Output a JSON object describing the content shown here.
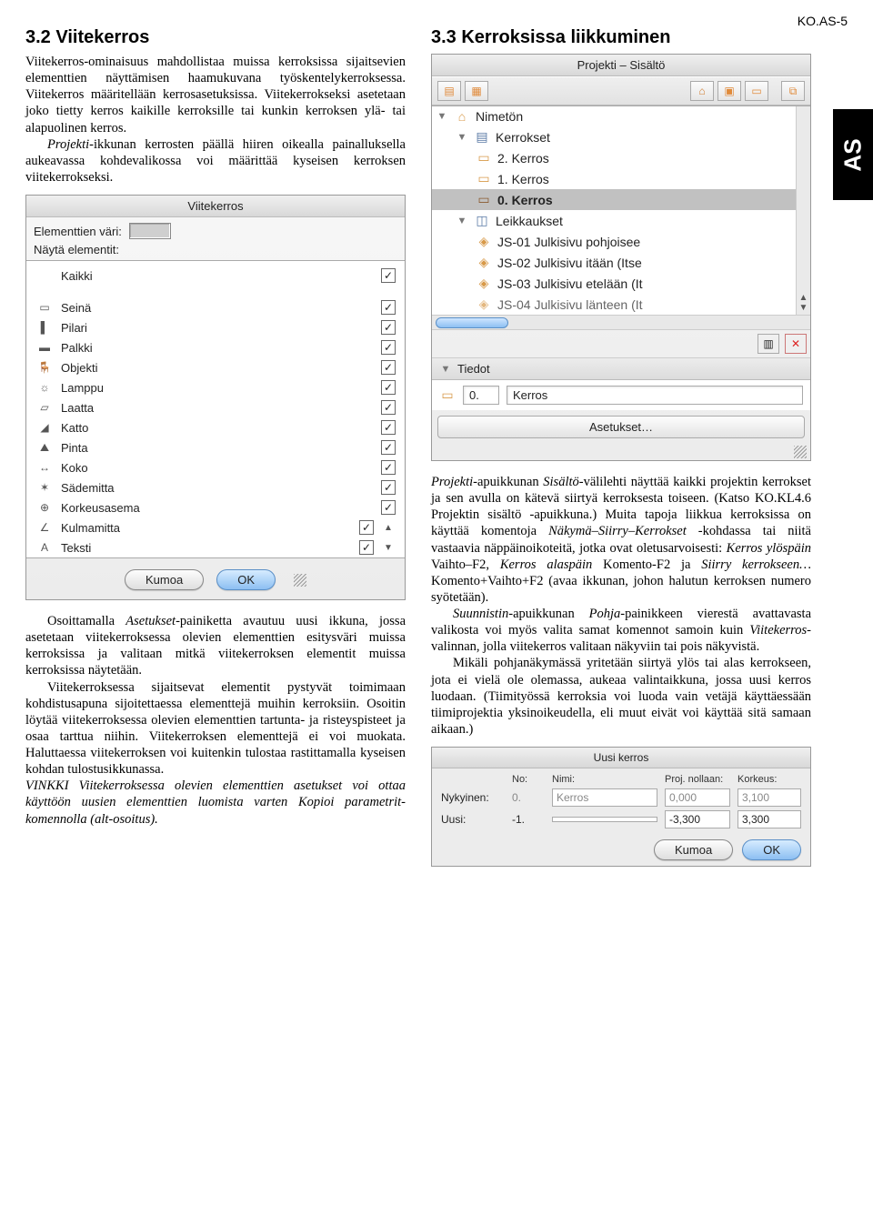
{
  "header": {
    "code": "KO.AS-5",
    "side_tab": "AS"
  },
  "left": {
    "heading": "3.2   Viitekerros",
    "p1": "Viitekerros-ominaisuus mahdollistaa muissa kerroksissa sijaitsevien elementtien näyttämisen haamukuvana työskentelykerroksessa. Viitekerros määritellään kerrosasetuksissa. Viitekerrokseksi asetetaan joko tietty kerros kaikille kerroksille tai kunkin kerroksen ylä- tai alapuolinen kerros.",
    "p2a": "Projekti",
    "p2b": "-ikkunan kerrosten päällä hiiren oikealla painalluksella aukeavassa kohdevalikossa voi määrittää kyseisen kerroksen viitekerrokseksi.",
    "p3a": "Osoittamalla ",
    "p3b": "Asetukset",
    "p3c": "-painiketta avautuu uusi ikkuna, jossa asetetaan viitekerroksessa olevien elementtien esitysväri muissa kerroksissa ja valitaan mitkä viitekerroksen elementit muissa kerroksissa näytetään.",
    "p4": "Viitekerroksessa sijaitsevat elementit pystyvät toimimaan kohdistusapuna sijoitettaessa elementtejä muihin kerroksiin. Osoitin löytää viitekerroksessa olevien elementtien tartunta- ja risteyspisteet ja osaa tarttua niihin. Viitekerroksen elementtejä ei voi muokata. Haluttaessa viitekerroksen voi kuitenkin tulostaa rastittamalla kyseisen kohdan tulostusikkunassa.",
    "tip": "VINKKI Viitekerroksessa olevien elementtien asetukset voi ottaa käyttöön uusien elementtien luomista varten Kopioi parametrit-komennolla (alt-osoitus)."
  },
  "right": {
    "heading": "3.3   Kerroksissa liikkuminen",
    "p1a": "Projekti",
    "p1b": "-apuikkunan ",
    "p1c": "Sisältö",
    "p1d": "-välilehti näyttää kaikki projektin kerrokset ja sen avulla on kätevä siirtyä kerroksesta toiseen. (Katso KO.KL4.6 Projektin sisältö -apuikkuna.) Muita tapoja liikkua kerroksissa on käyttää komentoja ",
    "p1e": "Näkymä–Siirry–Kerrokset",
    "p1f": " -kohdassa tai niitä vastaavia näppäinoikoteitä, jotka ovat oletusarvoisesti: ",
    "p1g": "Kerros ylöspäin",
    "p1h": " Vaihto–F2, ",
    "p1i": "Kerros alaspäin",
    "p1j": " Komento-F2 ja ",
    "p1k": "Siirry kerrokseen…",
    "p1l": " Komento+Vaihto+F2 (avaa ikkunan, johon halutun kerroksen numero syötetään).",
    "p2a": "Suunnistin",
    "p2b": "-apuikkunan ",
    "p2c": "Pohja",
    "p2d": "-painikkeen vierestä avattavasta valikosta voi myös valita samat komennot samoin kuin ",
    "p2e": "Viitekerros",
    "p2f": "-valinnan, jolla viitekerros valitaan näkyviin tai pois näkyvistä.",
    "p3": "Mikäli pohjanäkymässä yritetään siirtyä ylös tai alas kerrokseen, jota ei vielä ole olemassa, aukeaa valintaikkuna, jossa uusi kerros luodaan. (Tiimityössä kerroksia voi luoda vain vetäjä käyttäessään tiimiprojektia yksinoikeudella, eli muut eivät voi käyttää sitä samaan aikaan.)"
  },
  "viitekerros_panel": {
    "title": "Viitekerros",
    "color_label": "Elementtien väri:",
    "show_label": "Näytä elementit:",
    "all_label": "Kaikki",
    "items": [
      "Seinä",
      "Pilari",
      "Palkki",
      "Objekti",
      "Lamppu",
      "Laatta",
      "Katto",
      "Pinta",
      "Koko",
      "Sädemitta",
      "Korkeusasema",
      "Kulmamitta",
      "Teksti"
    ],
    "cancel": "Kumoa",
    "ok": "OK"
  },
  "projekti_panel": {
    "title": "Projekti – Sisältö",
    "tree": {
      "root": "Nimetön",
      "group1": "Kerrokset",
      "k2": "2. Kerros",
      "k1": "1. Kerros",
      "k0": "0. Kerros",
      "group2": "Leikkaukset",
      "js1": "JS-01 Julkisivu pohjoisee",
      "js2": "JS-02 Julkisivu itään (Itse",
      "js3": "JS-03 Julkisivu etelään (It",
      "js4": "JS-04 Julkisivu länteen (It"
    },
    "tiedot": "Tiedot",
    "field_no": "0.",
    "field_name": "Kerros",
    "asetukset": "Asetukset…"
  },
  "uusi_panel": {
    "title": "Uusi kerros",
    "h_no": "No:",
    "h_nimi": "Nimi:",
    "h_proj": "Proj. nollaan:",
    "h_korkeus": "Korkeus:",
    "row1_label": "Nykyinen:",
    "row1_no": "0.",
    "row1_nimi": "Kerros",
    "row1_proj": "0,000",
    "row1_k": "3,100",
    "row2_label": "Uusi:",
    "row2_no": "-1.",
    "row2_nimi": "",
    "row2_proj": "-3,300",
    "row2_k": "3,300",
    "cancel": "Kumoa",
    "ok": "OK"
  }
}
